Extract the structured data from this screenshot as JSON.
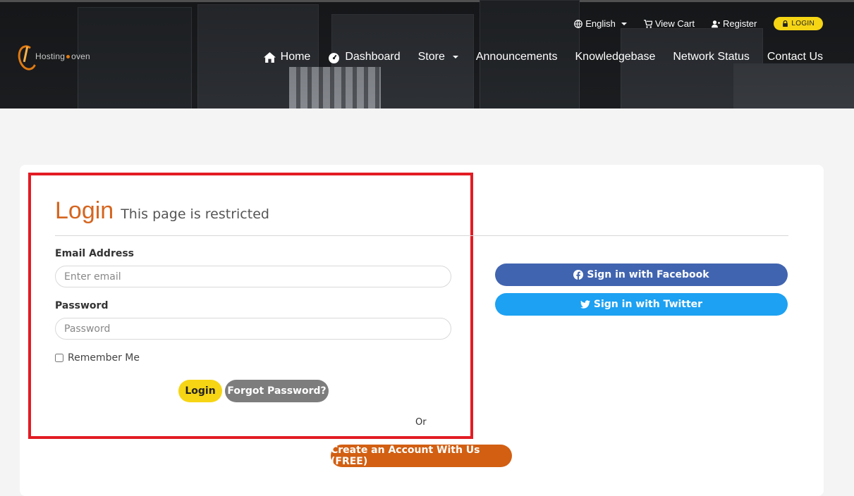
{
  "brand": {
    "logo_text_left": "Hosting",
    "logo_text_right": "oven"
  },
  "topbar": {
    "language": "English",
    "view_cart": "View Cart",
    "register": "Register",
    "login": "LOGIN"
  },
  "nav": {
    "home": "Home",
    "dashboard": "Dashboard",
    "store": "Store",
    "announcements": "Announcements",
    "knowledgebase": "Knowledgebase",
    "network_status": "Network Status",
    "contact_us": "Contact Us"
  },
  "login_form": {
    "title": "Login",
    "subtitle": "This page is restricted",
    "email_label": "Email Address",
    "email_placeholder": "Enter email",
    "password_label": "Password",
    "password_placeholder": "Password",
    "remember_label": "Remember Me",
    "login_button": "Login",
    "forgot_button": "Forgot Password?",
    "or_text": "Or",
    "create_button": "Create an Account With Us (FREE)"
  },
  "social": {
    "facebook": "Sign in with Facebook",
    "twitter": "Sign in with Twitter"
  },
  "colors": {
    "accent_orange": "#d5651f",
    "login_yellow": "#f6d514",
    "facebook_blue": "#4164b0",
    "twitter_blue": "#1da1f2",
    "highlight_red": "#e31b23"
  }
}
